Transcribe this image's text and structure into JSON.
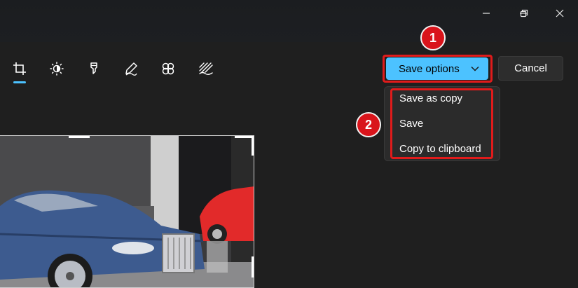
{
  "window": {
    "controls": {
      "minimize_icon": "minimize-icon",
      "restore_icon": "restore-icon",
      "close_icon": "close-icon"
    }
  },
  "toolbar": {
    "tools": [
      {
        "name": "crop",
        "icon": "crop-icon",
        "active": true
      },
      {
        "name": "adjustment",
        "icon": "brightness-icon"
      },
      {
        "name": "markup",
        "icon": "highlighter-icon"
      },
      {
        "name": "draw",
        "icon": "pen-icon"
      },
      {
        "name": "filter",
        "icon": "filter-icon"
      },
      {
        "name": "retouch",
        "icon": "background-blur-icon"
      }
    ],
    "accent_color": "#4cc2ff"
  },
  "actions": {
    "save_options_label": "Save options",
    "cancel_label": "Cancel"
  },
  "save_menu": {
    "items": [
      "Save as copy",
      "Save",
      "Copy to clipboard"
    ]
  },
  "annotations": {
    "step1": "1",
    "step2": "2",
    "highlight_color": "#e01b1b"
  },
  "image": {
    "subject": "photo-of-cars"
  }
}
